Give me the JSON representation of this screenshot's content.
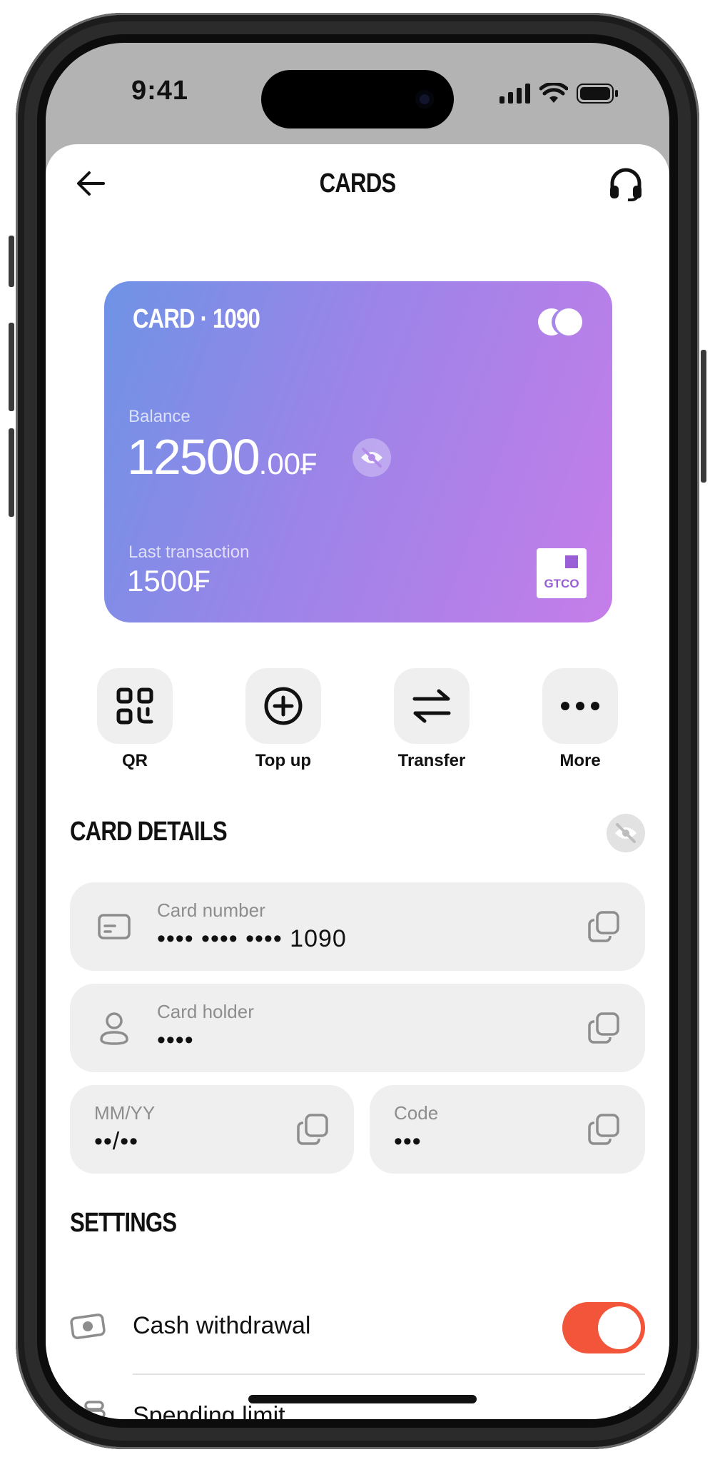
{
  "status_bar": {
    "time": "9:41"
  },
  "nav": {
    "title": "CARDS",
    "back_icon": "arrow-left-icon",
    "support_icon": "headset-icon"
  },
  "card": {
    "name": "CARD · 1090",
    "balance_label": "Balance",
    "balance_int": "12500",
    "balance_dec": ".00",
    "balance_currency": "₣",
    "last_label": "Last transaction",
    "last_value": "1500₣",
    "bank_logo_text": "GTCO",
    "gradient_colors": [
      "#6e93e6",
      "#c57de9"
    ]
  },
  "actions": [
    {
      "label": "QR",
      "icon": "qr-code-icon"
    },
    {
      "label": "Top up",
      "icon": "plus-circle-icon"
    },
    {
      "label": "Transfer",
      "icon": "transfer-arrows-icon"
    },
    {
      "label": "More",
      "icon": "more-dots-icon"
    }
  ],
  "card_details": {
    "title": "CARD DETAILS",
    "number": {
      "label": "Card number",
      "value": "•••• •••• •••• 1090"
    },
    "holder": {
      "label": "Card holder",
      "value": "••••"
    },
    "expiry": {
      "label": "MM/YY",
      "value": "••/••"
    },
    "code": {
      "label": "Code",
      "value": "•••"
    }
  },
  "settings": {
    "title": "SETTINGS",
    "items": [
      {
        "label": "Cash withdrawal",
        "icon": "cash-icon",
        "toggle_on": true
      },
      {
        "label": "Spending limit",
        "icon": "coins-icon"
      }
    ]
  },
  "colors": {
    "toggle_on": "#f2553a",
    "field_bg": "#efefef"
  }
}
